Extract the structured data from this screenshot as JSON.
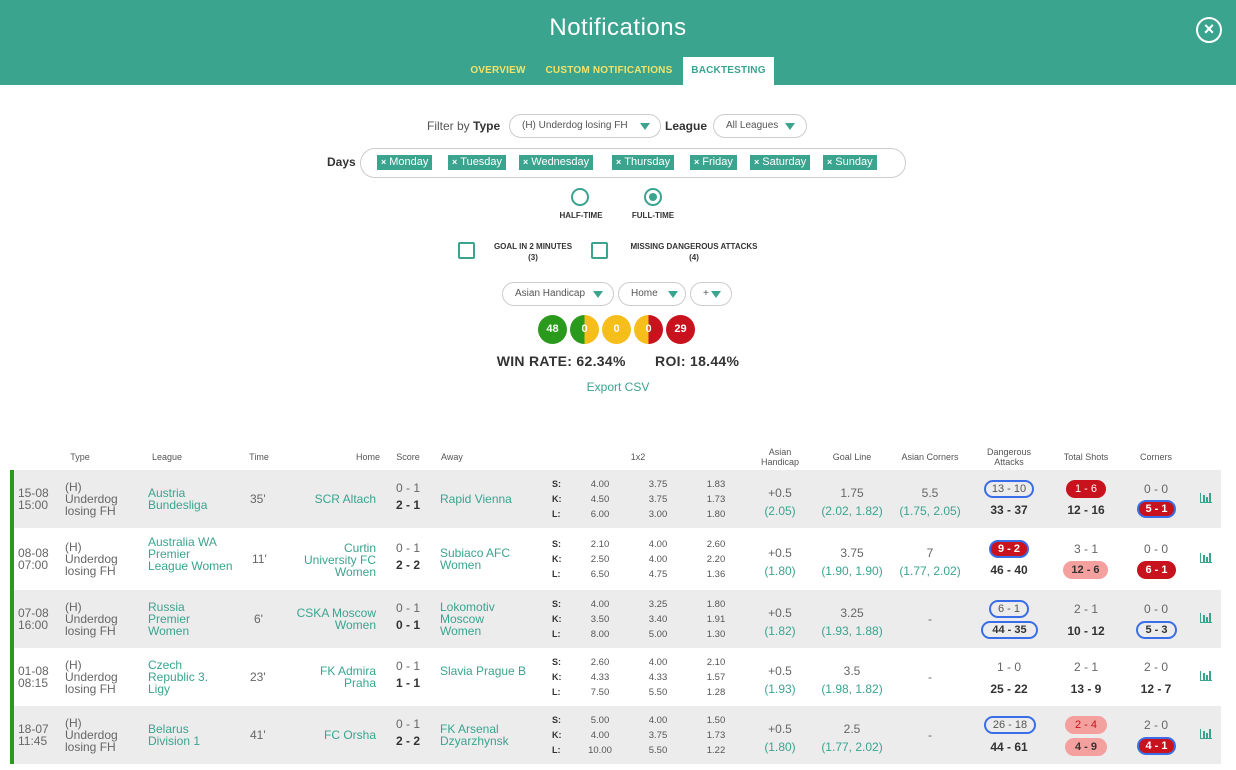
{
  "header": {
    "title": "Notifications"
  },
  "tabs": [
    {
      "label": "OVERVIEW",
      "active": false
    },
    {
      "label": "CUSTOM NOTIFICATIONS",
      "active": false
    },
    {
      "label": "BACKTESTING",
      "active": true
    }
  ],
  "filters": {
    "filter_by_label": "Filter by",
    "type_label": "Type",
    "type_value": "(H) Underdog losing FH",
    "league_label": "League",
    "league_value": "All Leagues",
    "days_label": "Days",
    "days": [
      "Monday",
      "Tuesday",
      "Wednesday",
      "Thursday",
      "Friday",
      "Saturday",
      "Sunday"
    ],
    "period_options": [
      {
        "label": "HALF-TIME",
        "selected": false
      },
      {
        "label": "FULL-TIME",
        "selected": true
      }
    ],
    "checkboxes": [
      {
        "label": "GOAL IN 2 MINUTES",
        "count": "(3)",
        "checked": false
      },
      {
        "label": "MISSING DANGEROUS ATTACKS",
        "count": "(4)",
        "checked": false
      }
    ],
    "market": "Asian Handicap",
    "side": "Home",
    "sign": "+"
  },
  "results": {
    "counts": [
      "48",
      "0",
      "0",
      "0",
      "29"
    ],
    "win_rate": "WIN RATE: 62.34%",
    "roi": "ROI: 18.44%",
    "export_label": "Export CSV"
  },
  "colors": {
    "accent": "#3aa48f",
    "win": "#2a9a1c",
    "half": "#f5be1a",
    "loss": "#c8121e",
    "highlight": "#3a6ee8"
  },
  "table": {
    "headers": {
      "type": "Type",
      "league": "League",
      "time": "Time",
      "home": "Home",
      "score": "Score",
      "away": "Away",
      "odds": "1x2",
      "asian": "Asian Handicap",
      "goal_line": "Goal Line",
      "asian_corners": "Asian Corners",
      "dangerous": "Dangerous Attacks",
      "shots": "Total Shots",
      "corners": "Corners"
    },
    "odds_labels": [
      "S:",
      "K:",
      "L:"
    ],
    "rows": [
      {
        "date": "15-08",
        "time_of_day": "15:00",
        "type": "(H) Underdog losing FH",
        "league": "Austria Bundesliga",
        "minute": "35'",
        "home": "SCR Altach",
        "score_ht": "0 - 1",
        "score_ft": "2 - 1",
        "away": "Rapid Vienna",
        "odds": [
          [
            "4.00",
            "3.75",
            "1.83"
          ],
          [
            "4.50",
            "3.75",
            "1.73"
          ],
          [
            "6.00",
            "3.00",
            "1.80"
          ]
        ],
        "asian": "+0.5",
        "asian_odds": "(2.05)",
        "goal_line": "1.75",
        "goal_line_odds": "(2.02, 1.82)",
        "asian_corners": "5.5",
        "asian_corners_odds": "(1.75, 2.05)",
        "da_ht": "13 - 10",
        "da_ft": "33 - 37",
        "shots_ht": "1 - 6",
        "shots_ft": "12 - 16",
        "corners_ht": "0 - 0",
        "corners_ft": "5 - 1"
      },
      {
        "date": "08-08",
        "time_of_day": "07:00",
        "type": "(H) Underdog losing FH",
        "league": "Australia WA Premier League Women",
        "minute": "11'",
        "home": "Curtin University FC Women",
        "score_ht": "0 - 1",
        "score_ft": "2 - 2",
        "away": "Subiaco AFC Women",
        "odds": [
          [
            "2.10",
            "4.00",
            "2.60"
          ],
          [
            "2.50",
            "4.00",
            "2.20"
          ],
          [
            "6.50",
            "4.75",
            "1.36"
          ]
        ],
        "asian": "+0.5",
        "asian_odds": "(1.80)",
        "goal_line": "3.75",
        "goal_line_odds": "(1.90, 1.90)",
        "asian_corners": "7",
        "asian_corners_odds": "(1.77, 2.02)",
        "da_ht": "9 - 2",
        "da_ft": "46 - 40",
        "shots_ht": "3 - 1",
        "shots_ft": "12 - 6",
        "corners_ht": "0 - 0",
        "corners_ft": "6 - 1"
      },
      {
        "date": "07-08",
        "time_of_day": "16:00",
        "type": "(H) Underdog losing FH",
        "league": "Russia Premier Women",
        "minute": "6'",
        "home": "CSKA Moscow Women",
        "score_ht": "0 - 1",
        "score_ft": "0 - 1",
        "away": "Lokomotiv Moscow Women",
        "odds": [
          [
            "4.00",
            "3.25",
            "1.80"
          ],
          [
            "3.50",
            "3.40",
            "1.91"
          ],
          [
            "8.00",
            "5.00",
            "1.30"
          ]
        ],
        "asian": "+0.5",
        "asian_odds": "(1.82)",
        "goal_line": "3.25",
        "goal_line_odds": "(1.93, 1.88)",
        "asian_corners": "-",
        "asian_corners_odds": "",
        "da_ht": "6 - 1",
        "da_ft": "44 - 35",
        "shots_ht": "2 - 1",
        "shots_ft": "10 - 12",
        "corners_ht": "0 - 0",
        "corners_ft": "5 - 3"
      },
      {
        "date": "01-08",
        "time_of_day": "08:15",
        "type": "(H) Underdog losing FH",
        "league": "Czech Republic 3. Ligy",
        "minute": "23'",
        "home": "FK Admira Praha",
        "score_ht": "0 - 1",
        "score_ft": "1 - 1",
        "away": "Slavia Prague B",
        "odds": [
          [
            "2.60",
            "4.00",
            "2.10"
          ],
          [
            "4.33",
            "4.33",
            "1.57"
          ],
          [
            "7.50",
            "5.50",
            "1.28"
          ]
        ],
        "asian": "+0.5",
        "asian_odds": "(1.93)",
        "goal_line": "3.5",
        "goal_line_odds": "(1.98, 1.82)",
        "asian_corners": "-",
        "asian_corners_odds": "",
        "da_ht": "1 - 0",
        "da_ft": "25 - 22",
        "shots_ht": "2 - 1",
        "shots_ft": "13 - 9",
        "corners_ht": "2 - 0",
        "corners_ft": "12 - 7"
      },
      {
        "date": "18-07",
        "time_of_day": "11:45",
        "type": "(H) Underdog losing FH",
        "league": "Belarus Division 1",
        "minute": "41'",
        "home": "FC Orsha",
        "score_ht": "0 - 1",
        "score_ft": "2 - 2",
        "away": "FK Arsenal Dzyarzhynsk",
        "odds": [
          [
            "5.00",
            "4.00",
            "1.50"
          ],
          [
            "4.00",
            "3.75",
            "1.73"
          ],
          [
            "10.00",
            "5.50",
            "1.22"
          ]
        ],
        "asian": "+0.5",
        "asian_odds": "(1.80)",
        "goal_line": "2.5",
        "goal_line_odds": "(1.77, 2.02)",
        "asian_corners": "-",
        "asian_corners_odds": "",
        "da_ht": "26 - 18",
        "da_ft": "44 - 61",
        "shots_ht": "2 - 4",
        "shots_ft": "4 - 9",
        "corners_ht": "2 - 0",
        "corners_ft": "4 - 1"
      }
    ]
  }
}
